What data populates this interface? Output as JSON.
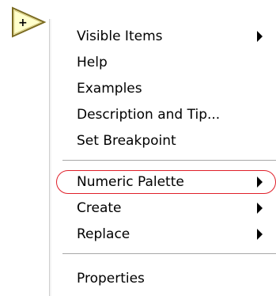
{
  "icon": {
    "name": "add-function-icon",
    "symbol": "+"
  },
  "menu": {
    "items": [
      {
        "label": "Visible Items",
        "submenu": true
      },
      {
        "label": "Help",
        "submenu": false
      },
      {
        "label": "Examples",
        "submenu": false
      },
      {
        "label": "Description and Tip...",
        "submenu": false
      },
      {
        "label": "Set Breakpoint",
        "submenu": false
      },
      {
        "label": "Numeric Palette",
        "submenu": true,
        "highlighted": true
      },
      {
        "label": "Create",
        "submenu": true
      },
      {
        "label": "Replace",
        "submenu": true
      },
      {
        "label": "Properties",
        "submenu": false
      }
    ]
  },
  "colors": {
    "icon_fill": "#ffffcc",
    "icon_stroke": "#7a6a20",
    "highlight_ring": "#e0202a",
    "separator": "#a8a8a8"
  }
}
